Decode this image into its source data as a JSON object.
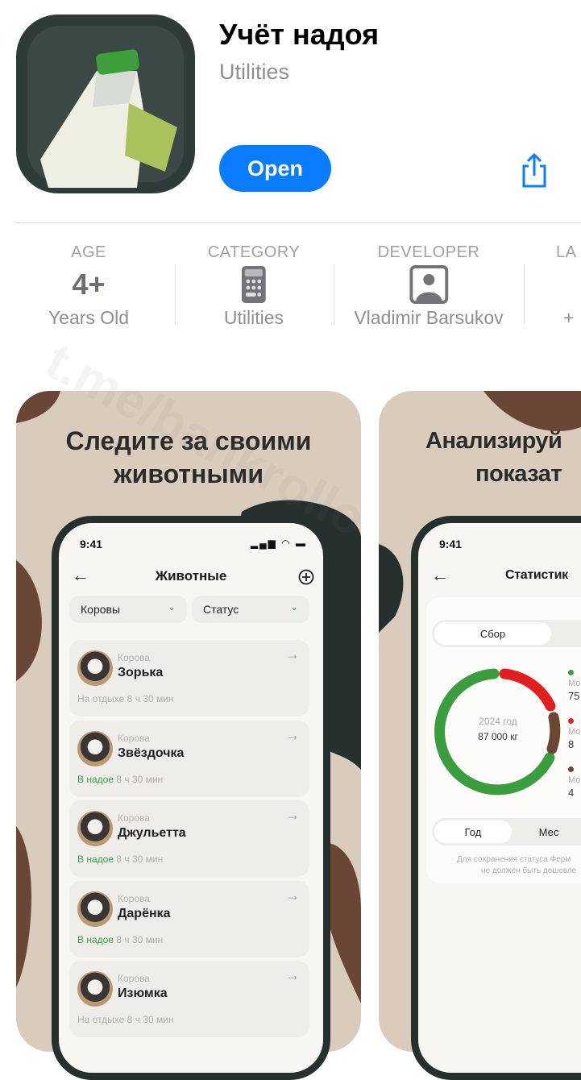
{
  "app": {
    "title": "Учёт надоя",
    "category": "Utilities",
    "open_label": "Open"
  },
  "info": [
    {
      "label": "AGE",
      "value": "4+",
      "sub": "Years Old"
    },
    {
      "label": "CATEGORY",
      "icon": "calculator-icon",
      "sub": "Utilities"
    },
    {
      "label": "DEVELOPER",
      "icon": "person-icon",
      "sub": "Vladimir Barsukov"
    },
    {
      "label": "LA",
      "sub": "+"
    }
  ],
  "watermark": "t.me/bankrollo",
  "screens": [
    {
      "heading": [
        "Следите за своими",
        "животными"
      ],
      "time": "9:41",
      "title": "Животные",
      "filters": [
        "Коровы",
        "Статус"
      ],
      "items": [
        {
          "kind": "Корова",
          "name": "Зорька",
          "status_label": "",
          "status": "На отдыхе 8 ч 30 мин"
        },
        {
          "kind": "Корова",
          "name": "Звёздочка",
          "status_label": "В надое",
          "status": " 8 ч 30 мин"
        },
        {
          "kind": "Корова",
          "name": "Джульетта",
          "status_label": "В надое",
          "status": " 8 ч 30 мин"
        },
        {
          "kind": "Корова",
          "name": "Дарёнка",
          "status_label": "В надое",
          "status": " 8 ч 30 мин"
        },
        {
          "kind": "Корова",
          "name": "Изюмка",
          "status_label": "",
          "status": "На отдыхе 8 ч 30 мин"
        }
      ]
    },
    {
      "heading": [
        "Анализируй",
        "показат"
      ],
      "time": "9:41",
      "title": "Статистик",
      "tab_active": "Сбор",
      "donut_center": [
        "2024 год",
        "87 000 кг"
      ],
      "legend": [
        {
          "color": "#3a9e3f",
          "label": "Мо",
          "value": "75"
        },
        {
          "color": "#e21f1f",
          "label": "Мо",
          "value": "8"
        },
        {
          "color": "#6b4634",
          "label": "Мо",
          "value": "4"
        }
      ],
      "period": [
        "Год",
        "Мес"
      ],
      "note": [
        "Для сохранения статуса Ферм",
        "не должен быть дешевле"
      ]
    }
  ],
  "colors": {
    "accent": "#0a7cff",
    "card_bg": "#d9ccbd",
    "green": "#3a9e3f",
    "red": "#e21f1f",
    "brown": "#6b4634"
  }
}
